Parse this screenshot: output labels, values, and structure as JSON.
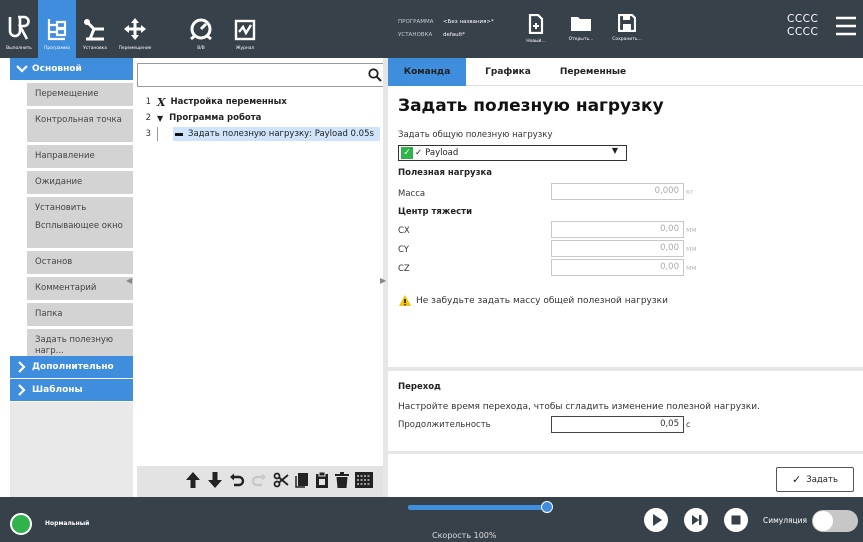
{
  "topbar": {
    "run_label": "Выполнить",
    "program_label": "Программа",
    "installation_label": "Установка",
    "move_label": "Перемещение",
    "io_label": "В/В",
    "log_label": "Журнал",
    "program_field_label": "ПРОГРАММА",
    "program_name": "<Без названия>*",
    "installation_field_label": "УСТАНОВКА",
    "installation_name": "default*",
    "new_label": "Новый...",
    "open_label": "Открыть...",
    "save_label": "Сохранить...",
    "cccc_1": "CCCC",
    "cccc_2": "CCCC"
  },
  "left_panel": {
    "basic": "Основной",
    "items": [
      "Перемещение",
      "Контрольная точка",
      "Направление",
      "Ожидание",
      "Установить",
      "Всплывающее окно",
      "Останов",
      "Комментарий",
      "Папка",
      "Задать полезную нагр..."
    ],
    "advanced": "Дополнительно",
    "templates": "Шаблоны"
  },
  "tree": {
    "search_value": "",
    "rows": [
      {
        "num": "1",
        "label": "Настройка переменных"
      },
      {
        "num": "2",
        "label": "Программа робота"
      },
      {
        "num": "3",
        "label": "Задать полезную нагрузку: Payload 0.05s"
      }
    ]
  },
  "tabs": [
    "Команда",
    "Графика",
    "Переменные"
  ],
  "command": {
    "title": "Задать полезную нагрузку",
    "set_total_label": "Задать общую полезную нагрузку",
    "dropdown_value": "Payload",
    "payload_section": "Полезная нагрузка",
    "mass_label": "Масса",
    "mass_value": "0,000",
    "mass_unit": "кг",
    "cog_section": "Центр тяжести",
    "cx_label": "CX",
    "cx_value": "0,00",
    "cy_label": "CY",
    "cy_value": "0,00",
    "cz_label": "CZ",
    "cz_value": "0,00",
    "length_unit": "мм",
    "warning_text": "Не забудьте задать массу общей полезной нагрузки",
    "transition_section": "Переход",
    "transition_desc": "Настройте время перехода, чтобы сгладить изменение полезной нагрузки.",
    "duration_label": "Продолжительность",
    "duration_value": "0,05",
    "duration_unit": "с",
    "apply_label": "Задать"
  },
  "bottom": {
    "status": "Нормальный",
    "speed_label": "Скорость 100%",
    "speed_fraction": 1.0,
    "simulation_label": "Симуляция"
  },
  "colors": {
    "accent": "#3f8ddd",
    "topbar": "#37414a",
    "status_green": "#2fb34a",
    "warning": "#f3c300"
  }
}
